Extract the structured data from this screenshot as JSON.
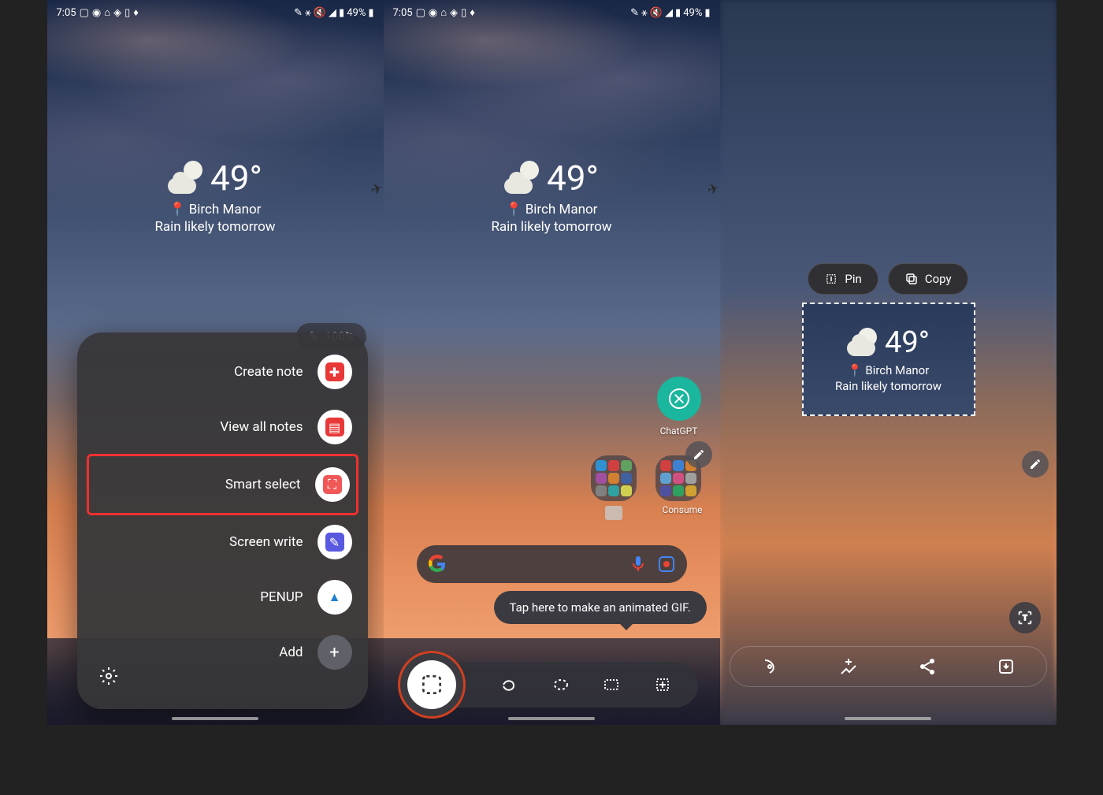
{
  "status": {
    "time": "7:05",
    "battery": "49%"
  },
  "weather": {
    "temp": "49°",
    "location": "Birch Manor",
    "forecast": "Rain likely tomorrow"
  },
  "pen": {
    "percent": "100%"
  },
  "airCommand": {
    "items": [
      {
        "label": "Create note",
        "color": "#e83838"
      },
      {
        "label": "View all notes",
        "color": "#e83838"
      },
      {
        "label": "Smart select",
        "color": "#f05858",
        "highlighted": true
      },
      {
        "label": "Screen write",
        "color": "#5858e0"
      },
      {
        "label": "PENUP",
        "color": "#ffffff"
      },
      {
        "label": "Add",
        "color": "#606068"
      }
    ]
  },
  "apps": {
    "chatgpt": "ChatGPT",
    "consume": "Consume"
  },
  "tooltip": "Tap here to make an animated GIF.",
  "panel3": {
    "pin": "Pin",
    "copy": "Copy"
  }
}
